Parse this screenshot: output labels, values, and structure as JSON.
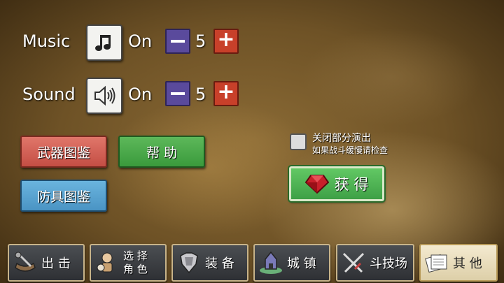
{
  "settings": {
    "music": {
      "label": "Music",
      "state": "On",
      "value": "5",
      "icon": "music-note-icon"
    },
    "sound": {
      "label": "Sound",
      "state": "On",
      "value": "5",
      "icon": "speaker-icon"
    },
    "minus_label": "−",
    "plus_label": "+"
  },
  "buttons": {
    "weapon_guide": "武器图鉴",
    "help": "帮 助",
    "armor_guide": "防具图鉴",
    "obtain": "获 得"
  },
  "option": {
    "checkbox_label": "关闭部分演出",
    "checkbox_hint": "如果战斗缓慢请检查",
    "checked": false
  },
  "colors": {
    "red_button": "#c44e44",
    "green_button": "#3a9a3c",
    "blue_button": "#4a94c4",
    "minus": "#5a4a9c",
    "plus": "#c8402a"
  },
  "nav": [
    {
      "label": "出 击",
      "icon": "catapult-icon"
    },
    {
      "label_line1": "选 择",
      "label_line2": "角 色",
      "icon": "character-icon"
    },
    {
      "label": "装 备",
      "icon": "armor-icon"
    },
    {
      "label": "城 镇",
      "icon": "castle-icon"
    },
    {
      "label": "斗技场",
      "icon": "crossed-swords-icon"
    },
    {
      "label": "其 他",
      "icon": "notes-icon",
      "active": true
    }
  ]
}
